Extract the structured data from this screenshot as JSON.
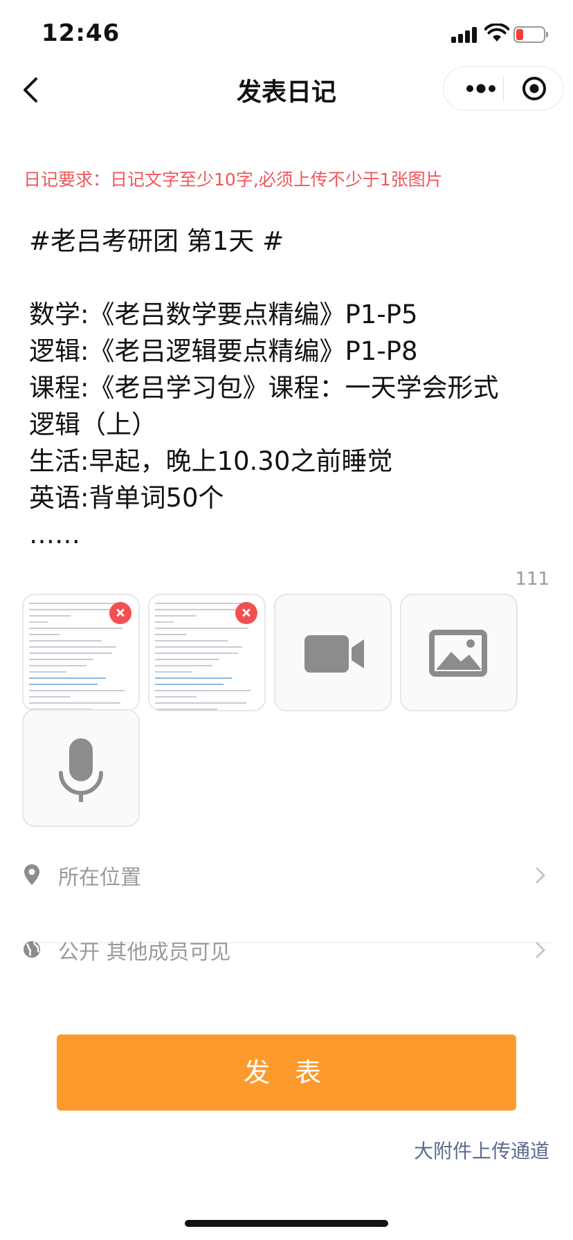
{
  "status_bar": {
    "time": "12:46"
  },
  "nav": {
    "title": "发表日记"
  },
  "requirement": "日记要求：日记文字至少10字,必须上传不少于1张图片",
  "diary": {
    "lines": [
      "#老吕考研团 第1天 #",
      "",
      "数学:《老吕数学要点精编》P1-P5",
      "逻辑:《老吕逻辑要点精编》P1-P8",
      "课程:《老吕学习包》课程：一天学会形式",
      "逻辑（上）",
      "生活:早起，晚上10.30之前睡觉",
      "英语:背单词50个",
      "……"
    ],
    "char_count": "111"
  },
  "media": {
    "tiles": [
      {
        "kind": "image-thumbnail",
        "removable": true
      },
      {
        "kind": "image-thumbnail",
        "removable": true
      },
      {
        "kind": "video-add",
        "icon": "video-camera-icon"
      },
      {
        "kind": "image-add",
        "icon": "image-icon"
      },
      {
        "kind": "audio-add",
        "icon": "microphone-icon"
      }
    ]
  },
  "location": {
    "label": "所在位置",
    "icon": "location-pin-icon"
  },
  "visibility": {
    "label": "公开 其他成员可见",
    "icon": "globe-icon"
  },
  "publish": {
    "label": "发 表"
  },
  "attachment_link": "大附件上传通道",
  "colors": {
    "accent_orange": "#fd9a2e",
    "requirement_red": "#f0555a",
    "remove_red": "#f25050",
    "link_blue_gray": "#5b6b8d"
  }
}
